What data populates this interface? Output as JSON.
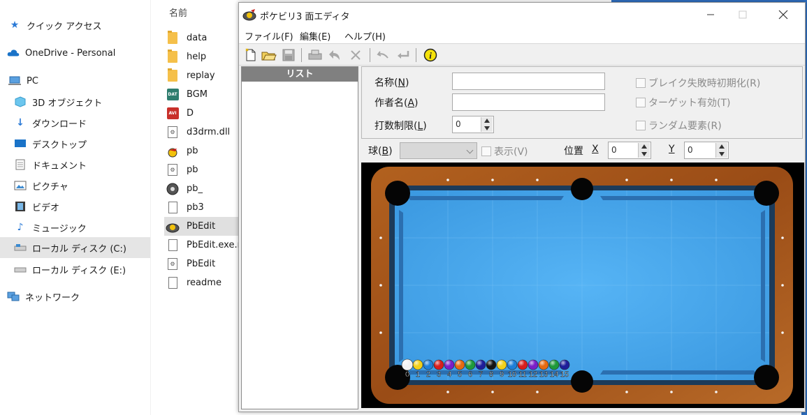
{
  "explorer": {
    "nav": [
      {
        "label": "クイック アクセス",
        "icon": "star-icon"
      },
      {
        "label": "OneDrive - Personal",
        "icon": "cloud-icon"
      },
      {
        "label": "PC",
        "icon": "pc-icon"
      },
      {
        "label": "3D オブジェクト",
        "icon": "cube-icon"
      },
      {
        "label": "ダウンロード",
        "icon": "download-icon"
      },
      {
        "label": "デスクトップ",
        "icon": "desktop-icon"
      },
      {
        "label": "ドキュメント",
        "icon": "document-icon"
      },
      {
        "label": "ピクチャ",
        "icon": "pictures-icon"
      },
      {
        "label": "ビデオ",
        "icon": "video-icon"
      },
      {
        "label": "ミュージック",
        "icon": "music-icon"
      },
      {
        "label": "ローカル ディスク (C:)",
        "icon": "drive-icon",
        "selected": true
      },
      {
        "label": "ローカル ディスク (E:)",
        "icon": "drive-icon"
      },
      {
        "label": "ネットワーク",
        "icon": "network-icon"
      }
    ],
    "column_header": "名前",
    "files": [
      {
        "name": "data",
        "type": "folder"
      },
      {
        "name": "help",
        "type": "folder"
      },
      {
        "name": "replay",
        "type": "folder"
      },
      {
        "name": "BGM",
        "type": "dat",
        "badge": "DAT"
      },
      {
        "name": "D",
        "type": "avi",
        "badge": "AVI"
      },
      {
        "name": "d3drm.dll",
        "type": "dll"
      },
      {
        "name": "pb",
        "type": "app"
      },
      {
        "name": "pb",
        "type": "settings"
      },
      {
        "name": "pb_",
        "type": "disc"
      },
      {
        "name": "pb3",
        "type": "doc"
      },
      {
        "name": "PbEdit",
        "type": "app",
        "selected": true
      },
      {
        "name": "PbEdit.exe.m",
        "type": "doc"
      },
      {
        "name": "PbEdit",
        "type": "settings"
      },
      {
        "name": "readme",
        "type": "doc"
      }
    ]
  },
  "app": {
    "title": "ポケビリ3 面エディタ",
    "menu": [
      "ファイル(F)",
      "編集(E)",
      "ヘルプ(H)"
    ],
    "list_header": "リスト",
    "props": {
      "name_label": "名称(",
      "name_key": "N",
      "author_label": "作者名(",
      "author_key": "A",
      "shots_label": "打数制限(",
      "shots_key": "L",
      "shots_value": "0",
      "close_paren": ")",
      "chk_break": "ブレイク失敗時初期化(R)",
      "chk_target": "ターゲット有効(T)",
      "chk_random": "ランダム要素(R)"
    },
    "ballrow": {
      "ball_label": "球(",
      "ball_key": "B",
      "show_label": "表示(V)",
      "pos_label": "位置",
      "x_label": "X",
      "x_value": "0",
      "y_label": "Y",
      "y_value": "0"
    },
    "balls": [
      "0",
      "1",
      "2",
      "3",
      "4",
      "5",
      "6",
      "7",
      "8",
      "9",
      "10",
      "11",
      "12",
      "13",
      "14",
      "15"
    ],
    "ball_colors": [
      "#f2f2f2",
      "#f2d11b",
      "#1e7fd8",
      "#d81e1e",
      "#7a1ec8",
      "#e56a12",
      "#1e9a3a",
      "#1e1e9a",
      "#141414",
      "#f2d11b",
      "#1e7fd8",
      "#d81e1e",
      "#7a1ec8",
      "#e56a12",
      "#1e9a3a",
      "#1e1e9a"
    ],
    "colors": {
      "felt": "#4aa8ef",
      "rail_wood": "#a9561c",
      "cushion": "#2b6fb0"
    }
  }
}
